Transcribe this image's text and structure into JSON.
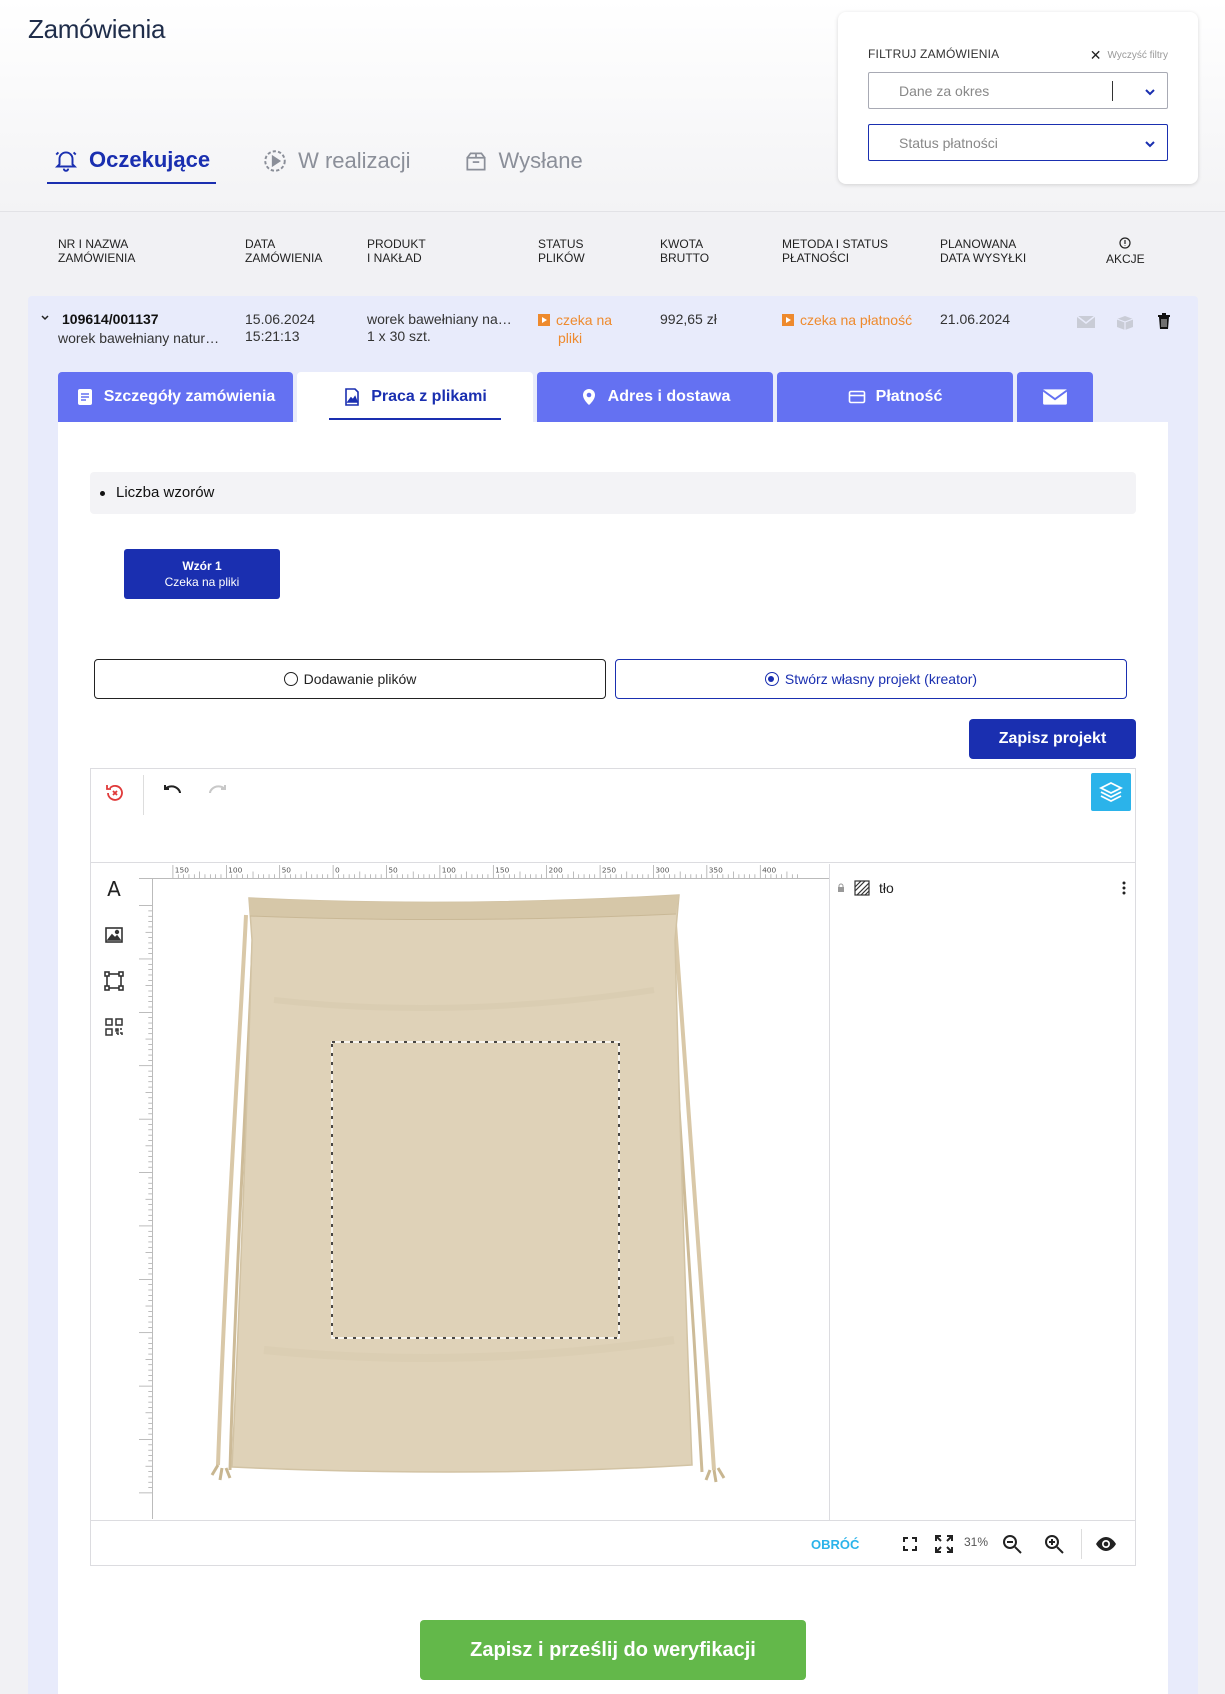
{
  "header": {
    "title": "Zamówienia",
    "tabs": [
      {
        "label": "Oczekujące",
        "icon": "bell-icon",
        "active": true
      },
      {
        "label": "W realizacji",
        "icon": "play-circle-icon",
        "active": false
      },
      {
        "label": "Wysłane",
        "icon": "package-icon",
        "active": false
      }
    ]
  },
  "filters": {
    "title": "FILTRUJ ZAMÓWIENIA",
    "clear_label": "Wyczyść filtry",
    "period_placeholder": "Dane za okres",
    "payment_status_placeholder": "Status płatności"
  },
  "table": {
    "headers": {
      "order_l1": "NR I NAZWA",
      "order_l2": "ZAMÓWIENIA",
      "date_l1": "DATA",
      "date_l2": "ZAMÓWIENIA",
      "product_l1": "PRODUKT",
      "product_l2": "I NAKŁAD",
      "files_l1": "STATUS",
      "files_l2": "PLIKÓW",
      "amount_l1": "KWOTA",
      "amount_l2": "BRUTTO",
      "payment_l1": "METODA I STATUS",
      "payment_l2": "PŁATNOŚCI",
      "ship_l1": "PLANOWANA",
      "ship_l2": "DATA WYSYŁKI",
      "actions": "AKCJE"
    },
    "row": {
      "order_number": "109614/001137",
      "order_name": "worek bawełniany natur…",
      "date": "15.06.2024",
      "time": "15:21:13",
      "product": "worek bawełniany na…",
      "quantity": "1 x 30 szt.",
      "file_status_l1": "czeka na",
      "file_status_l2": "pliki",
      "amount": "992,65 zł",
      "payment_status": "czeka na płatność",
      "ship_date": "21.06.2024"
    }
  },
  "sub_tabs": [
    {
      "label": "Szczegóły zamówienia",
      "icon": "document-icon"
    },
    {
      "label": "Praca z plikami",
      "icon": "image-file-icon",
      "active": true
    },
    {
      "label": "Adres i dostawa",
      "icon": "map-pin-icon"
    },
    {
      "label": "Płatność",
      "icon": "credit-card-icon"
    },
    {
      "label": "",
      "icon": "envelope-icon"
    }
  ],
  "files_section": {
    "designs_count_label": "Liczba wzorów",
    "design_button_title": "Wzór 1",
    "design_button_status": "Czeka na pliki",
    "option_upload": "Dodawanie plików",
    "option_creator": "Stwórz własny projekt (kreator)",
    "save_project": "Zapisz projekt"
  },
  "editor": {
    "layer_name": "tło",
    "rotate_label": "OBRÓĆ",
    "zoom": "31%",
    "ruler_labels": [
      "150",
      "100",
      "50",
      "0",
      "50",
      "100",
      "150",
      "200",
      "250",
      "300",
      "350",
      "400"
    ]
  },
  "submit_label": "Zapisz i prześlij do weryfikacji"
}
